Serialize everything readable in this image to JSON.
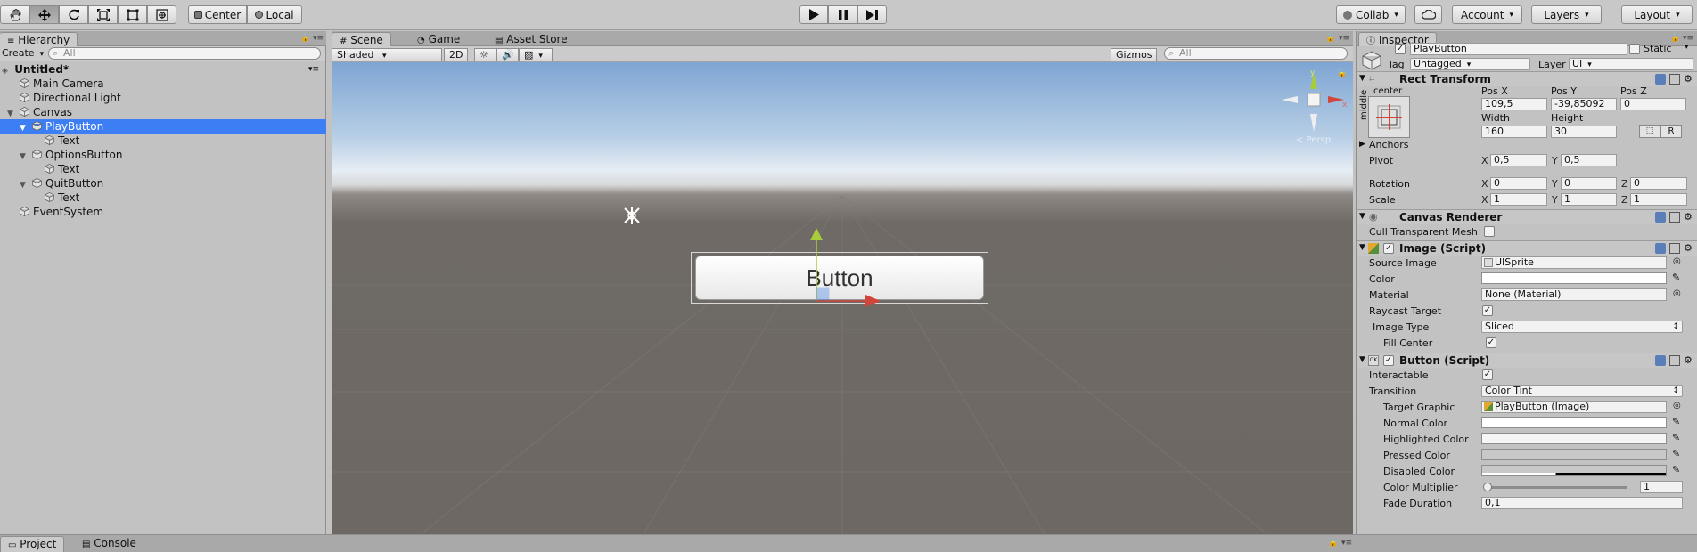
{
  "toolbar": {
    "tools": [
      "hand-tool",
      "move-tool",
      "rotate-tool",
      "scale-tool",
      "rect-tool",
      "transform-tool"
    ],
    "pivot_mode": "Center",
    "pivot_space": "Local",
    "collab": "Collab",
    "account": "Account",
    "layers": "Layers",
    "layout": "Layout"
  },
  "hierarchy": {
    "tab": "Hierarchy",
    "create": "Create",
    "search_placeholder": "All",
    "scene_name": "Untitled*",
    "items": [
      {
        "label": "Main Camera"
      },
      {
        "label": "Directional Light"
      },
      {
        "label": "Canvas"
      },
      {
        "label": "PlayButton"
      },
      {
        "label": "Text"
      },
      {
        "label": "OptionsButton"
      },
      {
        "label": "Text"
      },
      {
        "label": "QuitButton"
      },
      {
        "label": "Text"
      },
      {
        "label": "EventSystem"
      }
    ]
  },
  "scene": {
    "tabs": {
      "scene": "Scene",
      "game": "Game",
      "asset_store": "Asset Store"
    },
    "shading_mode": "Shaded",
    "mode_2d": "2D",
    "gizmos": "Gizmos",
    "search_placeholder": "All",
    "button_text": "Button",
    "persp_label": "< Persp"
  },
  "inspector": {
    "tab": "Inspector",
    "object_name": "PlayButton",
    "static_label": "Static",
    "tag_label": "Tag",
    "tag_value": "Untagged",
    "layer_label": "Layer",
    "layer_value": "UI",
    "rect_transform": {
      "title": "Rect Transform",
      "anchor_h": "center",
      "anchor_v": "middle",
      "pos_x_label": "Pos X",
      "pos_x": "109,5",
      "pos_y_label": "Pos Y",
      "pos_y": "-39,85092",
      "pos_z_label": "Pos Z",
      "pos_z": "0",
      "width_label": "Width",
      "width": "160",
      "height_label": "Height",
      "height": "30",
      "r_button": "R",
      "anchors": "Anchors",
      "pivot_label": "Pivot",
      "pivot_x": "0,5",
      "pivot_y": "0,5",
      "rotation_label": "Rotation",
      "rot_x": "0",
      "rot_y": "0",
      "rot_z": "0",
      "scale_label": "Scale",
      "scale_x": "1",
      "scale_y": "1",
      "scale_z": "1",
      "x": "X",
      "y": "Y",
      "z": "Z"
    },
    "canvas_renderer": {
      "title": "Canvas Renderer",
      "cull_label": "Cull Transparent Mesh"
    },
    "image": {
      "title": "Image (Script)",
      "source_label": "Source Image",
      "source_value": "UISprite",
      "color_label": "Color",
      "material_label": "Material",
      "material_value": "None (Material)",
      "raycast_label": "Raycast Target",
      "type_label": "Image Type",
      "type_value": "Sliced",
      "fill_label": "Fill Center"
    },
    "button": {
      "title": "Button (Script)",
      "interactable_label": "Interactable",
      "transition_label": "Transition",
      "transition_value": "Color Tint",
      "target_label": "Target Graphic",
      "target_value": "PlayButton (Image)",
      "normal_label": "Normal Color",
      "highlighted_label": "Highlighted Color",
      "pressed_label": "Pressed Color",
      "disabled_label": "Disabled Color",
      "multiplier_label": "Color Multiplier",
      "multiplier_value": "1",
      "multiplier_fraction": 0.0,
      "fade_label": "Fade Duration",
      "fade_value": "0,1"
    }
  },
  "bottom": {
    "project": "Project",
    "console": "Console"
  },
  "colors": {
    "selection": "#3d7ef4",
    "axis_x": "#d2453a",
    "axis_y": "#a9cc3c",
    "axis_z": "#3c7ee8"
  }
}
